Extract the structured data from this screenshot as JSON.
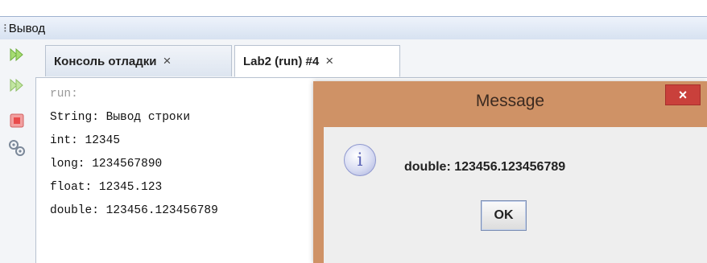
{
  "panel": {
    "title": "Вывод"
  },
  "tabs": [
    {
      "label": "Консоль отладки",
      "close": "×"
    },
    {
      "label": "Lab2 (run) #4",
      "close": "×"
    }
  ],
  "console": {
    "lines": [
      "run:",
      "String: Вывод строки",
      "int: 12345",
      "long: 1234567890",
      "float: 12345.123",
      "double: 123456.123456789"
    ]
  },
  "dialog": {
    "title": "Message",
    "close": "×",
    "message": "double: 123456.123456789",
    "ok_label": "OK"
  },
  "toolbar": {
    "icons": [
      "rerun-icon",
      "rerun-with-args-icon",
      "stop-icon",
      "settings-icon"
    ]
  },
  "colors": {
    "dialog_frame": "#cf9266",
    "close_button": "#c9403b",
    "panel_header": "#dbe5f2",
    "rerun_icon": "#8ccc55"
  }
}
